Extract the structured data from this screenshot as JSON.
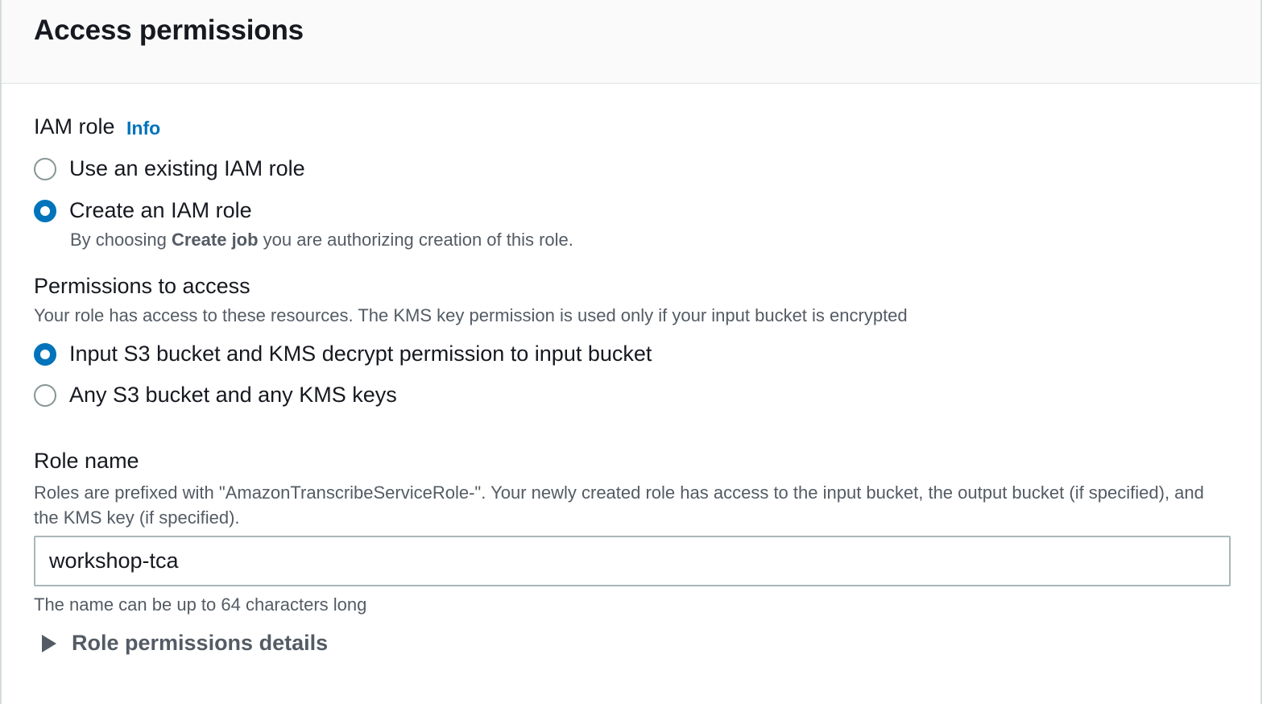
{
  "section": {
    "title": "Access permissions"
  },
  "iam_role": {
    "label": "IAM role",
    "info_link": "Info",
    "options": [
      {
        "label": "Use an existing IAM role",
        "selected": false
      },
      {
        "label": "Create an IAM role",
        "selected": true
      }
    ],
    "create_desc_prefix": "By choosing ",
    "create_desc_bold": "Create job",
    "create_desc_suffix": " you are authorizing creation of this role."
  },
  "permissions": {
    "label": "Permissions to access",
    "description": "Your role has access to these resources. The KMS key permission is used only if your input bucket is encrypted",
    "options": [
      {
        "label": "Input S3 bucket and KMS decrypt permission to input bucket",
        "selected": true
      },
      {
        "label": "Any S3 bucket and any KMS keys",
        "selected": false
      }
    ]
  },
  "role_name": {
    "label": "Role name",
    "description": "Roles are prefixed with \"AmazonTranscribeServiceRole-\". Your newly created role has access to the input bucket, the output bucket (if specified), and the KMS key (if specified).",
    "value": "workshop-tca",
    "hint": "The name can be up to 64 characters long"
  },
  "expander": {
    "label": "Role permissions details",
    "expanded": false
  },
  "colors": {
    "accent": "#0073bb",
    "text": "#16191f",
    "secondary_text": "#545b64",
    "header_bg": "#fafafa",
    "input_border": "#aab7b8"
  },
  "icons": {
    "expander": "caret-right-icon"
  }
}
